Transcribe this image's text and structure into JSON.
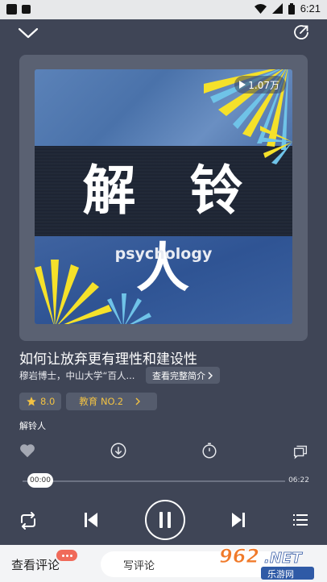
{
  "status_bar": {
    "time": "6:21"
  },
  "cover": {
    "title": "解 铃 人",
    "subtitle": "psychology",
    "play_count": "1.07万"
  },
  "episode": {
    "title": "如何让放弃更有理性和建设性",
    "author": "穆岩博士，中山大学“百人...",
    "intro_button": "查看完整简介"
  },
  "tags": {
    "rating": "8.0",
    "rank": "教育 NO.2"
  },
  "album": {
    "name": "解铃人"
  },
  "player": {
    "current_time": "00:00",
    "total_time": "06:22",
    "progress": 0
  },
  "bottom": {
    "view_comments": "查看评论",
    "write_comment": "写评论"
  },
  "watermark": {
    "text": "962.NET",
    "sub": "乐游网"
  },
  "colors": {
    "background": "#3f4556",
    "accent": "#f2c243",
    "card": "#5a6172"
  }
}
